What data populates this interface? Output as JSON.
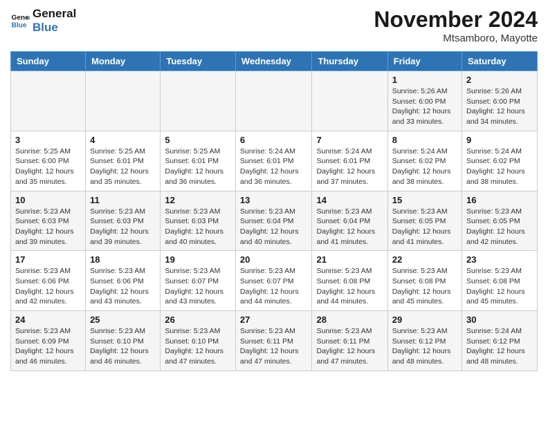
{
  "header": {
    "logo_line1": "General",
    "logo_line2": "Blue",
    "month": "November 2024",
    "location": "Mtsamboro, Mayotte"
  },
  "days_of_week": [
    "Sunday",
    "Monday",
    "Tuesday",
    "Wednesday",
    "Thursday",
    "Friday",
    "Saturday"
  ],
  "weeks": [
    [
      {
        "day": "",
        "info": ""
      },
      {
        "day": "",
        "info": ""
      },
      {
        "day": "",
        "info": ""
      },
      {
        "day": "",
        "info": ""
      },
      {
        "day": "",
        "info": ""
      },
      {
        "day": "1",
        "info": "Sunrise: 5:26 AM\nSunset: 6:00 PM\nDaylight: 12 hours and 33 minutes."
      },
      {
        "day": "2",
        "info": "Sunrise: 5:26 AM\nSunset: 6:00 PM\nDaylight: 12 hours and 34 minutes."
      }
    ],
    [
      {
        "day": "3",
        "info": "Sunrise: 5:25 AM\nSunset: 6:00 PM\nDaylight: 12 hours and 35 minutes."
      },
      {
        "day": "4",
        "info": "Sunrise: 5:25 AM\nSunset: 6:01 PM\nDaylight: 12 hours and 35 minutes."
      },
      {
        "day": "5",
        "info": "Sunrise: 5:25 AM\nSunset: 6:01 PM\nDaylight: 12 hours and 36 minutes."
      },
      {
        "day": "6",
        "info": "Sunrise: 5:24 AM\nSunset: 6:01 PM\nDaylight: 12 hours and 36 minutes."
      },
      {
        "day": "7",
        "info": "Sunrise: 5:24 AM\nSunset: 6:01 PM\nDaylight: 12 hours and 37 minutes."
      },
      {
        "day": "8",
        "info": "Sunrise: 5:24 AM\nSunset: 6:02 PM\nDaylight: 12 hours and 38 minutes."
      },
      {
        "day": "9",
        "info": "Sunrise: 5:24 AM\nSunset: 6:02 PM\nDaylight: 12 hours and 38 minutes."
      }
    ],
    [
      {
        "day": "10",
        "info": "Sunrise: 5:23 AM\nSunset: 6:03 PM\nDaylight: 12 hours and 39 minutes."
      },
      {
        "day": "11",
        "info": "Sunrise: 5:23 AM\nSunset: 6:03 PM\nDaylight: 12 hours and 39 minutes."
      },
      {
        "day": "12",
        "info": "Sunrise: 5:23 AM\nSunset: 6:03 PM\nDaylight: 12 hours and 40 minutes."
      },
      {
        "day": "13",
        "info": "Sunrise: 5:23 AM\nSunset: 6:04 PM\nDaylight: 12 hours and 40 minutes."
      },
      {
        "day": "14",
        "info": "Sunrise: 5:23 AM\nSunset: 6:04 PM\nDaylight: 12 hours and 41 minutes."
      },
      {
        "day": "15",
        "info": "Sunrise: 5:23 AM\nSunset: 6:05 PM\nDaylight: 12 hours and 41 minutes."
      },
      {
        "day": "16",
        "info": "Sunrise: 5:23 AM\nSunset: 6:05 PM\nDaylight: 12 hours and 42 minutes."
      }
    ],
    [
      {
        "day": "17",
        "info": "Sunrise: 5:23 AM\nSunset: 6:06 PM\nDaylight: 12 hours and 42 minutes."
      },
      {
        "day": "18",
        "info": "Sunrise: 5:23 AM\nSunset: 6:06 PM\nDaylight: 12 hours and 43 minutes."
      },
      {
        "day": "19",
        "info": "Sunrise: 5:23 AM\nSunset: 6:07 PM\nDaylight: 12 hours and 43 minutes."
      },
      {
        "day": "20",
        "info": "Sunrise: 5:23 AM\nSunset: 6:07 PM\nDaylight: 12 hours and 44 minutes."
      },
      {
        "day": "21",
        "info": "Sunrise: 5:23 AM\nSunset: 6:08 PM\nDaylight: 12 hours and 44 minutes."
      },
      {
        "day": "22",
        "info": "Sunrise: 5:23 AM\nSunset: 6:08 PM\nDaylight: 12 hours and 45 minutes."
      },
      {
        "day": "23",
        "info": "Sunrise: 5:23 AM\nSunset: 6:08 PM\nDaylight: 12 hours and 45 minutes."
      }
    ],
    [
      {
        "day": "24",
        "info": "Sunrise: 5:23 AM\nSunset: 6:09 PM\nDaylight: 12 hours and 46 minutes."
      },
      {
        "day": "25",
        "info": "Sunrise: 5:23 AM\nSunset: 6:10 PM\nDaylight: 12 hours and 46 minutes."
      },
      {
        "day": "26",
        "info": "Sunrise: 5:23 AM\nSunset: 6:10 PM\nDaylight: 12 hours and 47 minutes."
      },
      {
        "day": "27",
        "info": "Sunrise: 5:23 AM\nSunset: 6:11 PM\nDaylight: 12 hours and 47 minutes."
      },
      {
        "day": "28",
        "info": "Sunrise: 5:23 AM\nSunset: 6:11 PM\nDaylight: 12 hours and 47 minutes."
      },
      {
        "day": "29",
        "info": "Sunrise: 5:23 AM\nSunset: 6:12 PM\nDaylight: 12 hours and 48 minutes."
      },
      {
        "day": "30",
        "info": "Sunrise: 5:24 AM\nSunset: 6:12 PM\nDaylight: 12 hours and 48 minutes."
      }
    ]
  ]
}
